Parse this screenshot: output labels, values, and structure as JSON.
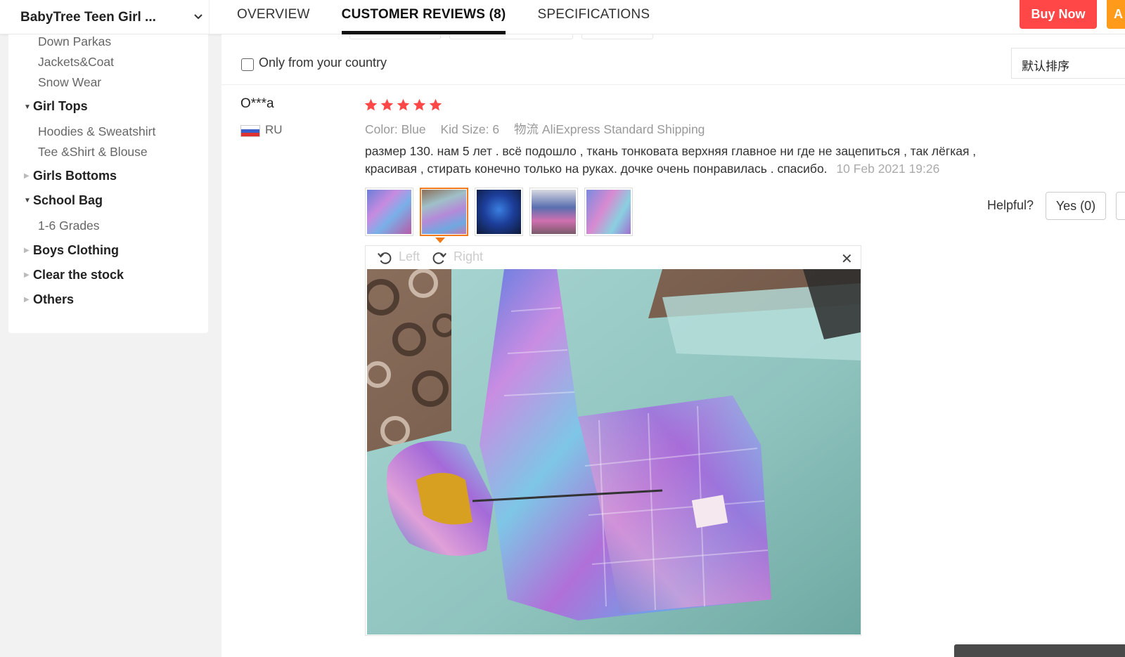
{
  "header": {
    "store_name": "BabyTree Teen Girl ...",
    "tabs": [
      {
        "label": "OVERVIEW",
        "active": false
      },
      {
        "label": "CUSTOMER REVIEWS (8)",
        "active": true
      },
      {
        "label": "SPECIFICATIONS",
        "active": false
      }
    ],
    "buy_now": "Buy Now",
    "add_to_cart_partial": "A"
  },
  "sidebar": {
    "items": [
      {
        "label": "Down Parkas",
        "level": "sub"
      },
      {
        "label": "Jackets&Coat",
        "level": "sub"
      },
      {
        "label": "Snow Wear",
        "level": "sub"
      },
      {
        "label": "Girl Tops",
        "level": "category",
        "expanded": true
      },
      {
        "label": "Hoodies & Sweatshirt",
        "level": "sub"
      },
      {
        "label": "Tee &Shirt & Blouse",
        "level": "sub"
      },
      {
        "label": "Girls Bottoms",
        "level": "category",
        "expanded": false
      },
      {
        "label": "School Bag",
        "level": "category",
        "expanded": true
      },
      {
        "label": "1-6 Grades",
        "level": "sub"
      },
      {
        "label": "Boys Clothing",
        "level": "category",
        "expanded": false
      },
      {
        "label": "Clear the stock",
        "level": "category",
        "expanded": false
      },
      {
        "label": "Others",
        "level": "category",
        "expanded": false
      }
    ]
  },
  "filters": {
    "only_country_label": "Only from your country",
    "only_country_checked": false,
    "sort_value": "默认排序"
  },
  "review": {
    "reviewer": "O***a",
    "country_code": "RU",
    "rating": 5,
    "color_label": "Color:",
    "color_value": "Blue",
    "size_label": "Kid Size:",
    "size_value": "6",
    "shipping_label": "物流",
    "shipping_value": "AliExpress Standard Shipping",
    "text_line1": "размер 130. нам 5 лет . всё подошло , ткань тонковата верхняя главное ни где не зацепиться , так лёгкая ,",
    "text_line2": "красивая , стирать конечно только на руках. дочке очень понравилась . спасибо.",
    "date": "10 Feb 2021 19:26",
    "thumbnail_count": 5,
    "selected_thumbnail": 2,
    "helpful_label": "Helpful?",
    "yes_label": "Yes (0)"
  },
  "viewer": {
    "rotate_left_label": "Left",
    "rotate_right_label": "Right",
    "close_icon": "close-icon"
  },
  "colors": {
    "buy_now": "#ff4747",
    "add_cart": "#ff9a1a",
    "stars": "#ff4747",
    "selected_thumb": "#f27a1a"
  }
}
